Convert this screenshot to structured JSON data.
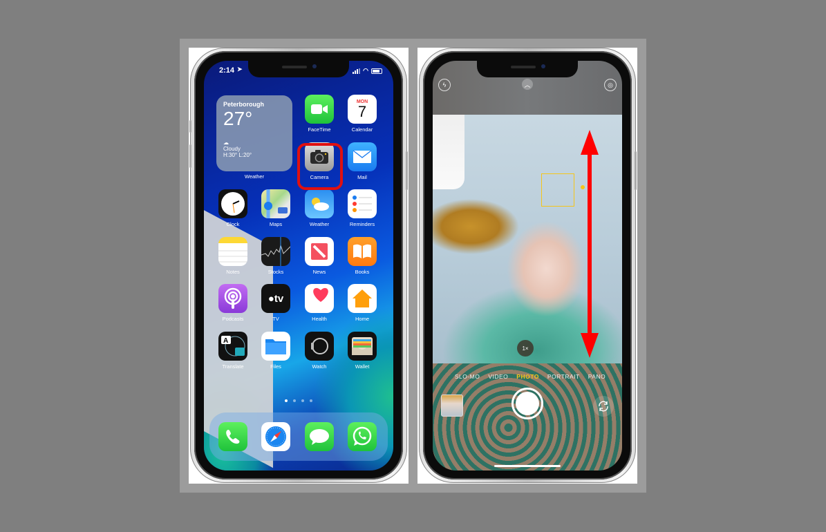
{
  "left_phone": {
    "status_bar": {
      "time": "2:14"
    },
    "weather_widget": {
      "city": "Peterborough",
      "temperature": "27°",
      "condition": "Cloudy",
      "high_low": "H:30° L:20°",
      "label": "Weather"
    },
    "apps": [
      {
        "name": "FaceTime",
        "icon": "facetime-icon"
      },
      {
        "name": "Calendar",
        "icon": "calendar-icon",
        "day": "MON",
        "date": "7"
      },
      {
        "name": "Camera",
        "icon": "camera-icon",
        "highlighted": true
      },
      {
        "name": "Mail",
        "icon": "mail-icon"
      },
      {
        "name": "Clock",
        "icon": "clock-icon"
      },
      {
        "name": "Maps",
        "icon": "maps-icon"
      },
      {
        "name": "Weather",
        "icon": "weather-icon"
      },
      {
        "name": "Reminders",
        "icon": "reminders-icon"
      },
      {
        "name": "Notes",
        "icon": "notes-icon"
      },
      {
        "name": "Stocks",
        "icon": "stocks-icon"
      },
      {
        "name": "News",
        "icon": "news-icon"
      },
      {
        "name": "Books",
        "icon": "books-icon"
      },
      {
        "name": "Podcasts",
        "icon": "podcasts-icon"
      },
      {
        "name": "TV",
        "icon": "tv-icon",
        "glyph": "tv"
      },
      {
        "name": "Health",
        "icon": "health-icon"
      },
      {
        "name": "Home",
        "icon": "home-icon"
      },
      {
        "name": "Translate",
        "icon": "translate-icon"
      },
      {
        "name": "Files",
        "icon": "files-icon"
      },
      {
        "name": "Watch",
        "icon": "watch-icon"
      },
      {
        "name": "Wallet",
        "icon": "wallet-icon"
      }
    ],
    "page_dots": {
      "count": 4,
      "active": 1
    },
    "dock": [
      {
        "name": "Phone",
        "icon": "phone-icon"
      },
      {
        "name": "Safari",
        "icon": "safari-icon"
      },
      {
        "name": "Messages",
        "icon": "messages-icon"
      },
      {
        "name": "WhatsApp",
        "icon": "whatsapp-icon"
      }
    ],
    "highlight_color": "#e01010"
  },
  "right_phone": {
    "top_controls": {
      "flash": "flash-off-icon",
      "expand": "chevron-up-icon",
      "live_photo": "live-photo-icon"
    },
    "zoom_level": "1×",
    "modes": [
      "SLO-MO",
      "VIDEO",
      "PHOTO",
      "PORTRAIT",
      "PANO"
    ],
    "active_mode": "PHOTO",
    "accent_color": "#f5c518",
    "annotation": {
      "type": "double-arrow-vertical",
      "color": "#ff0000"
    }
  }
}
